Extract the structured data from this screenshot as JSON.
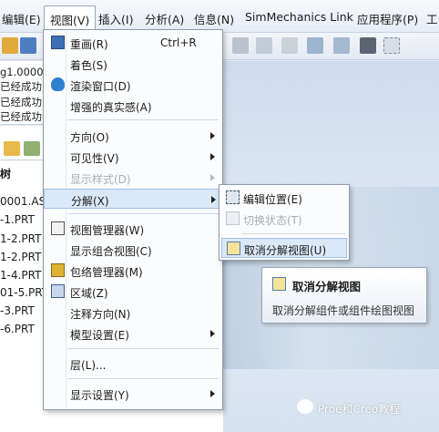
{
  "menubar": {
    "items": [
      "编辑(E)",
      "视图(V)",
      "插入(I)",
      "分析(A)",
      "信息(N)",
      "SimMechanics Link",
      "应用程序(P)",
      "工"
    ]
  },
  "messages": [
    "g1.0000时",
    "已经成功",
    "已经成功",
    "已经成功"
  ],
  "tree": {
    "header": "树",
    "items": [
      "0001.AS",
      "-1.PRT",
      "1-2.PRT",
      "1-2.PRT",
      "1-4.PRT",
      "01-5.PRT",
      "-3.PRT",
      "-6.PRT"
    ]
  },
  "view_menu": {
    "items": [
      {
        "label": "重画(R)",
        "shortcut": "Ctrl+R",
        "icon": "repaint-icon"
      },
      {
        "label": "着色(S)"
      },
      {
        "label": "渲染窗口(D)",
        "icon": "teapot-icon"
      },
      {
        "label": "增强的真实感(A)"
      },
      {
        "label": "方向(O)",
        "submenu": true
      },
      {
        "label": "可见性(V)",
        "submenu": true
      },
      {
        "label": "显示样式(D)",
        "submenu": true,
        "disabled": true
      },
      {
        "label": "分解(X)",
        "submenu": true,
        "highlighted": true
      },
      {
        "label": "视图管理器(W)",
        "icon": "view-manager-icon"
      },
      {
        "label": "显示组合视图(C)"
      },
      {
        "label": "包络管理器(M)",
        "icon": "envelope-icon"
      },
      {
        "label": "区域(Z)",
        "icon": "zone-icon"
      },
      {
        "label": "注释方向(N)"
      },
      {
        "label": "模型设置(E)",
        "submenu": true
      },
      {
        "label": "层(L)..."
      },
      {
        "label": "显示设置(Y)",
        "submenu": true
      }
    ]
  },
  "explode_submenu": {
    "items": [
      {
        "label": "编辑位置(E)",
        "icon": "edit-position-icon"
      },
      {
        "label": "切换状态(T)",
        "icon": "toggle-state-icon",
        "disabled": true
      },
      {
        "label": "取消分解视图(U)",
        "icon": "unexplode-icon",
        "highlighted": true
      }
    ]
  },
  "tooltip": {
    "title": "取消分解视图",
    "description": "取消分解组件或组件绘图视图"
  },
  "watermark": "Proe和Creo教程",
  "colors": {
    "highlight": "#dbe8f7",
    "highlight_border": "#9ec0e6",
    "disabled_text": "#a9adb3"
  }
}
